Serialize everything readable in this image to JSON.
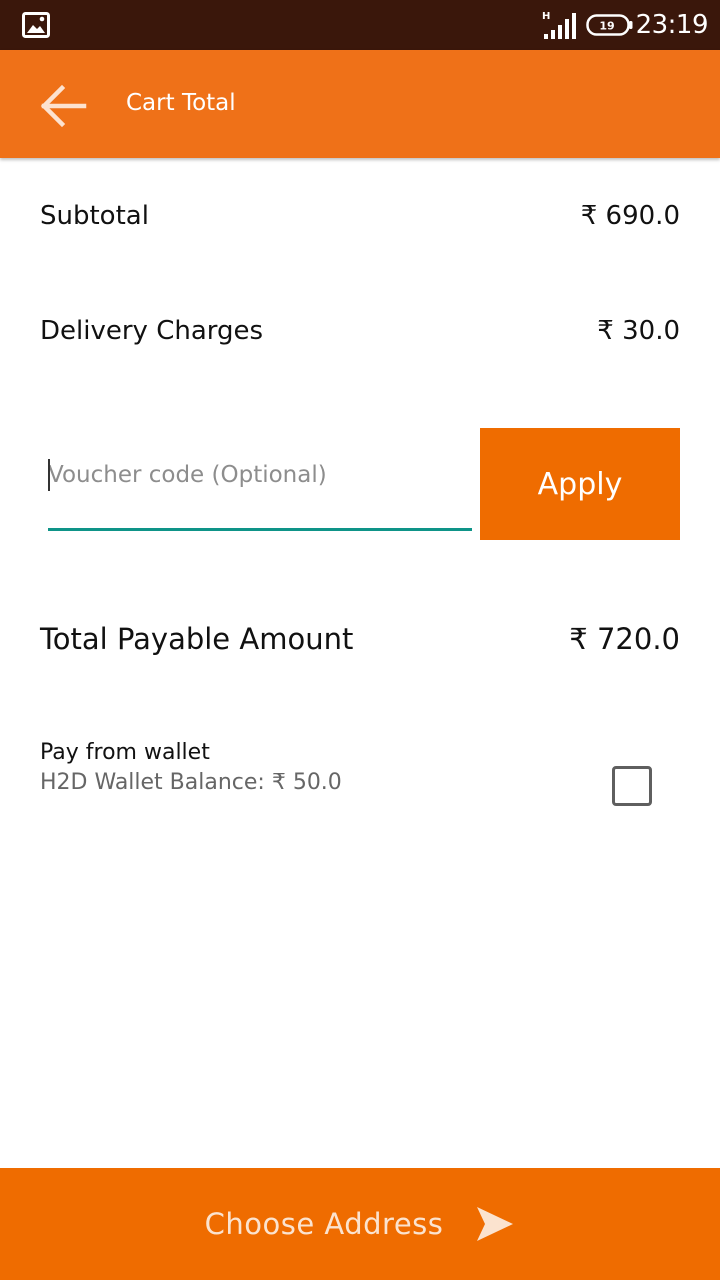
{
  "status_bar": {
    "time": "23:19",
    "network_type": "H",
    "battery_level": "19",
    "icons": [
      "photo-icon",
      "signal-icon",
      "battery-icon"
    ]
  },
  "app_bar": {
    "title": "Cart Total",
    "back_icon": "arrow-left-icon",
    "color": "#ef7118"
  },
  "summary": {
    "subtotal_label": "Subtotal",
    "subtotal_value": "₹ 690.0",
    "delivery_label": "Delivery Charges",
    "delivery_value": "₹ 30.0",
    "total_label": "Total Payable Amount",
    "total_value": "₹ 720.0"
  },
  "voucher": {
    "placeholder": "Voucher code (Optional)",
    "value": "",
    "apply_label": "Apply",
    "underline_color": "#0e9488"
  },
  "wallet": {
    "title": "Pay from wallet",
    "balance_text": "H2D Wallet Balance: ₹ 50.0",
    "checked": false
  },
  "bottom_action": {
    "label": "Choose Address",
    "icon": "send-icon",
    "color": "#ef6c00"
  }
}
